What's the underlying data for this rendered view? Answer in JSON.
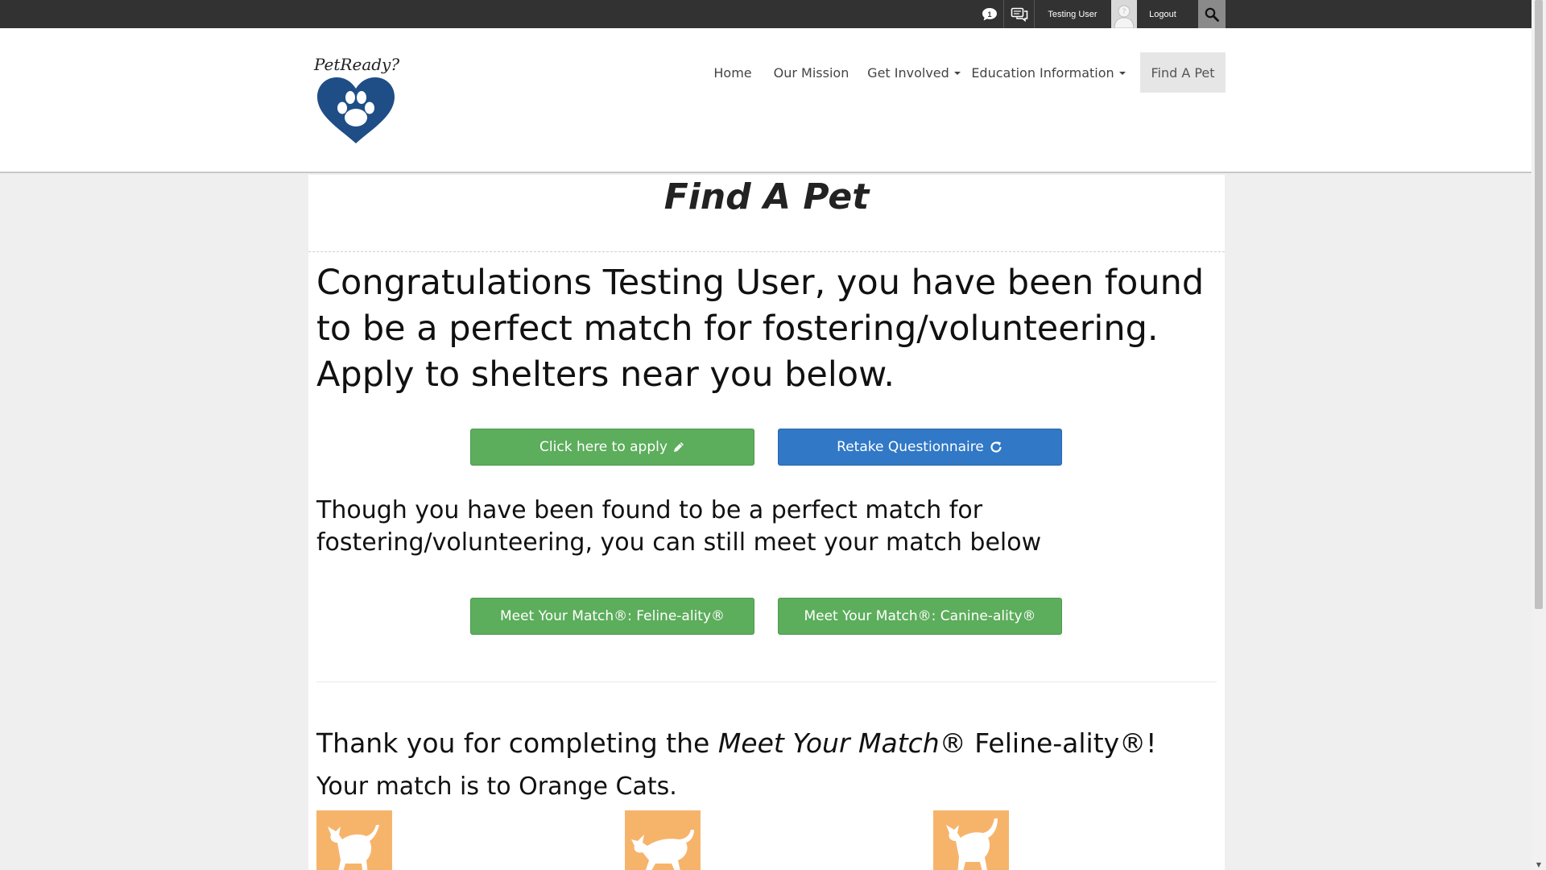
{
  "topbar": {
    "notifications_icon": "notification-bubble-icon",
    "messages_icon": "chat-bubbles-icon",
    "user_name": "Testing User",
    "avatar_icon": "user-silhouette-icon",
    "logout_label": "Logout",
    "search_icon": "magnifier-icon"
  },
  "header": {
    "logo_text": "PetReady?",
    "logo_icon": "paw-heart-icon",
    "nav": {
      "home": "Home",
      "mission": "Our Mission",
      "involved": "Get Involved",
      "education": "Education Information",
      "find": "Find A Pet"
    }
  },
  "main": {
    "title": "Find A Pet",
    "congrats": "Congratulations Testing User, you have been found to be a perfect match for fostering/volunteering. Apply to shelters near you below.",
    "apply_button": "Click here to apply",
    "apply_icon": "pencil-icon",
    "retake_button": "Retake Questionnaire",
    "retake_icon": "refresh-icon",
    "though": "Though you have been found to be a perfect match for fostering/volunteering, you can still meet your match below",
    "feline_button": "Meet Your Match®: Feline-ality®",
    "canine_button": "Meet Your Match®: Canine-ality®",
    "thanks_prefix": "Thank you for completing the ",
    "thanks_em": "Meet Your Match®",
    "thanks_suffix": " Feline-ality®!",
    "match_line": "Your match is to Orange Cats.",
    "cat_tile_icon": "cat-silhouette-icon"
  },
  "colors": {
    "topbar": "#323232",
    "green_button": "#5cad5c",
    "blue_button": "#3178c6",
    "logo_heart": "#1f4e86",
    "cat_tile": "#f6b46b"
  }
}
